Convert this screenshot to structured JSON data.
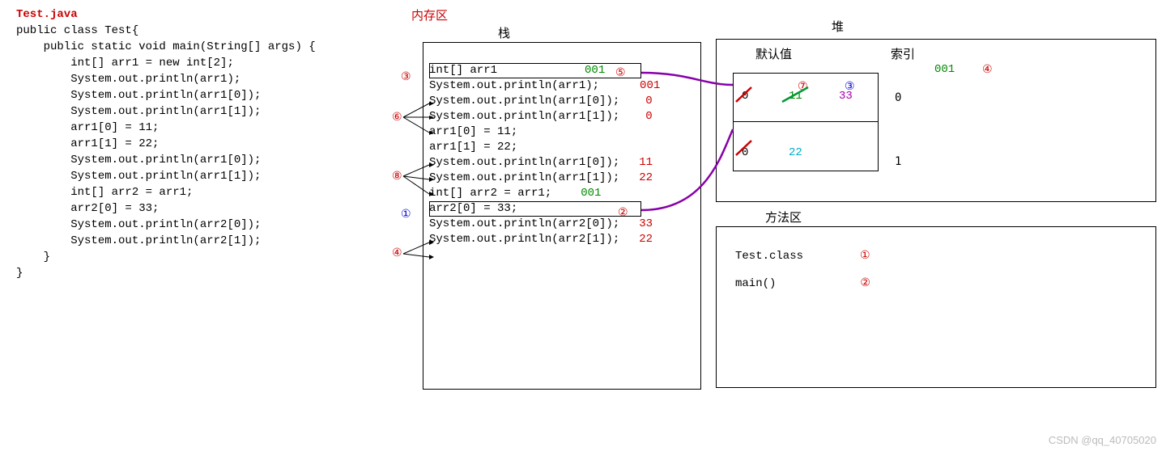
{
  "filename": "Test.java",
  "code": {
    "l1": "public class Test{",
    "l2": "    public static void main(String[] args) {",
    "l3": "        int[] arr1 = new int[2];",
    "l4": "        System.out.println(arr1);",
    "l5": "        System.out.println(arr1[0]);",
    "l6": "        System.out.println(arr1[1]);",
    "l7": "        arr1[0] = 11;",
    "l8": "        arr1[1] = 22;",
    "l9": "        System.out.println(arr1[0]);",
    "l10": "        System.out.println(arr1[1]);",
    "l11": "        int[] arr2 = arr1;",
    "l12": "        arr2[0] = 33;",
    "l13": "        System.out.println(arr2[0]);",
    "l14": "        System.out.println(arr2[1]);",
    "l15": "    }",
    "l16": "}"
  },
  "labels": {
    "memory": "内存区",
    "stack": "栈",
    "heap": "堆",
    "method_area": "方法区",
    "default_value": "默认值",
    "index": "索引"
  },
  "stack": {
    "s1": "int[] arr1",
    "s1addr": "001",
    "s2": "System.out.println(arr1);",
    "s2v": "001",
    "s3": "System.out.println(arr1[0]);",
    "s3v": "0",
    "s4": "System.out.println(arr1[1]);",
    "s4v": "0",
    "s5": "arr1[0] = 11;",
    "s6": "arr1[1] = 22;",
    "s7": "System.out.println(arr1[0]);",
    "s7v": "11",
    "s8": "System.out.println(arr1[1]);",
    "s8v": "22",
    "s9": "int[] arr2 = arr1;",
    "s9addr": "001",
    "s10": "arr2[0] = 33;",
    "s11": "System.out.println(arr2[0]);",
    "s11v": "33",
    "s12": "System.out.println(arr2[1]);",
    "s12v": "22"
  },
  "heap": {
    "addr": "001",
    "row0_old": "0",
    "row0_mid": "11",
    "row0_new": "33",
    "row0_idx": "0",
    "row1_old": "0",
    "row1_new": "22",
    "row1_idx": "1"
  },
  "method": {
    "m1": "Test.class",
    "m2": "main()"
  },
  "circles": {
    "c1": "①",
    "c2": "②",
    "c3": "③",
    "c4": "④",
    "c5": "⑤",
    "c6": "⑥",
    "c7": "⑦",
    "c8": "⑧"
  },
  "watermark": "CSDN @qq_40705020"
}
